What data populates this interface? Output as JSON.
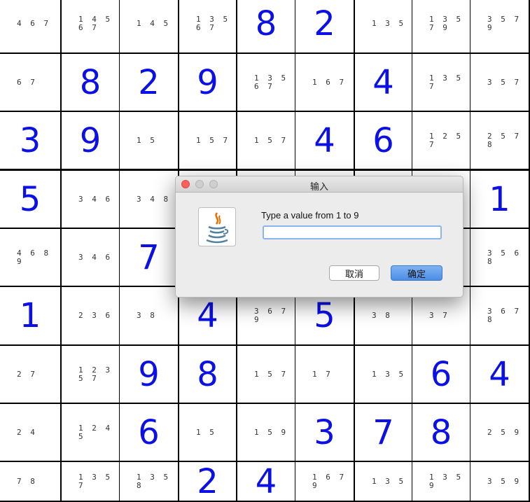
{
  "board": {
    "rows": [
      [
        {
          "c": "4 6 7"
        },
        {
          "c": "1 4 5\n6 7"
        },
        {
          "c": "1 4 5"
        },
        {
          "c": "1 3 5\n6 7"
        },
        {
          "v": "8"
        },
        {
          "v": "2"
        },
        {
          "c": "1 3 5"
        },
        {
          "c": "1 3 5\n7 9"
        },
        {
          "c": "3 5 7\n9"
        }
      ],
      [
        {
          "c": "6 7"
        },
        {
          "v": "8"
        },
        {
          "v": "2"
        },
        {
          "v": "9"
        },
        {
          "c": "1 3 5\n6 7"
        },
        {
          "c": "1 6 7"
        },
        {
          "v": "4"
        },
        {
          "c": "1 3 5\n7"
        },
        {
          "c": "3 5 7"
        }
      ],
      [
        {
          "v": "3"
        },
        {
          "v": "9"
        },
        {
          "c": "1 5"
        },
        {
          "c": "1 5 7"
        },
        {
          "c": "1 5 7"
        },
        {
          "v": "4"
        },
        {
          "v": "6"
        },
        {
          "c": "1 2 5\n7"
        },
        {
          "c": "2 5 7\n8"
        }
      ],
      [
        {
          "v": "5"
        },
        {
          "c": "3 4 6"
        },
        {
          "c": "3 4 8"
        },
        {
          "c": ""
        },
        {
          "c": ""
        },
        {
          "c": ""
        },
        {
          "c": ""
        },
        {
          "c": ""
        },
        {
          "v": "1"
        }
      ],
      [
        {
          "c": "4 6 8\n9"
        },
        {
          "c": "3 4 6"
        },
        {
          "v": "7"
        },
        {
          "c": ""
        },
        {
          "c": ""
        },
        {
          "c": ""
        },
        {
          "c": ""
        },
        {
          "c": ""
        },
        {
          "c": "3 5 6\n8"
        }
      ],
      [
        {
          "v": "1"
        },
        {
          "c": "2 3 6"
        },
        {
          "c": "3 8"
        },
        {
          "v": "4"
        },
        {
          "c": "3 6 7\n9"
        },
        {
          "v": "5"
        },
        {
          "c": "3 8"
        },
        {
          "c": "3 7"
        },
        {
          "c": "3 6 7\n8"
        }
      ],
      [
        {
          "c": "2 7"
        },
        {
          "c": "1 2 3\n5 7"
        },
        {
          "v": "9"
        },
        {
          "v": "8"
        },
        {
          "c": "1 5 7"
        },
        {
          "c": "1 7"
        },
        {
          "c": "1 3 5"
        },
        {
          "v": "6"
        },
        {
          "v": "4"
        }
      ],
      [
        {
          "c": "2 4"
        },
        {
          "c": "1 2 4\n5"
        },
        {
          "v": "6"
        },
        {
          "c": "1 5"
        },
        {
          "c": "1 5 9"
        },
        {
          "v": "3"
        },
        {
          "v": "7"
        },
        {
          "v": "8"
        },
        {
          "c": "2 5 9"
        }
      ],
      [
        {
          "c": "7 8"
        },
        {
          "c": "1 3 5\n7"
        },
        {
          "c": "1 3 5\n8"
        },
        {
          "v": "2"
        },
        {
          "v": "4"
        },
        {
          "c": "1 6 7\n9"
        },
        {
          "c": "1 3 5"
        },
        {
          "c": "1 3 5\n9"
        },
        {
          "c": "3 5 9"
        }
      ]
    ],
    "colors": {
      "given": "#0a10e6",
      "grid": "#000000",
      "cell": "#ffffff"
    }
  },
  "dialog": {
    "title": "输入",
    "prompt": "Type a value from 1 to 9",
    "input_value": "",
    "cancel_label": "取消",
    "ok_label": "确定",
    "icon": "java-icon"
  }
}
